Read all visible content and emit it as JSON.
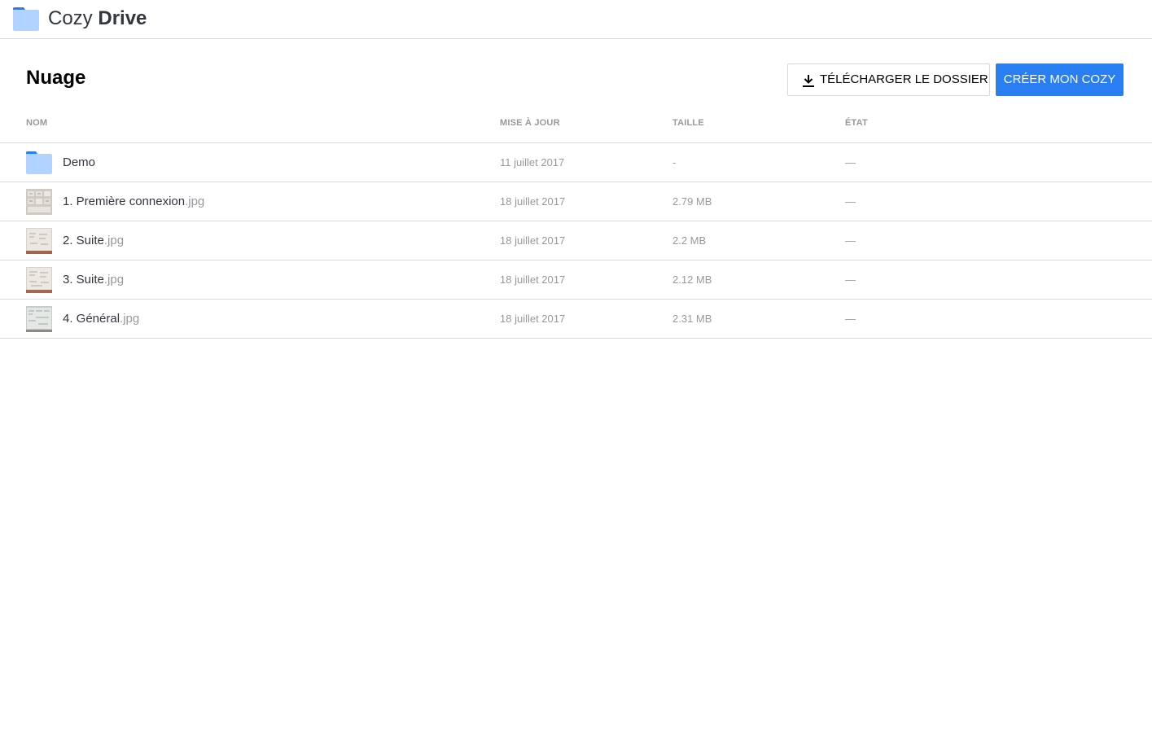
{
  "app": {
    "name_light": "Cozy",
    "name_bold": "Drive",
    "logo_icon": "folder-icon",
    "brand_color": "#297ef2"
  },
  "page": {
    "title": "Nuage"
  },
  "actions": {
    "download_label": "Télécharger le dossier",
    "download_icon": "download-icon",
    "create_label": "Créer mon Cozy"
  },
  "table": {
    "columns": {
      "name": "Nom",
      "updated": "Mise à jour",
      "size": "Taille",
      "state": "État"
    },
    "rows": [
      {
        "icon": "folder-icon",
        "name": "Demo",
        "ext": "",
        "date": "11 juillet 2017",
        "size": "-",
        "state": "—"
      },
      {
        "icon": "image-thumbnail",
        "name": "1. Première connexion",
        "ext": ".jpg",
        "date": "18 juillet 2017",
        "size": "2.79 MB",
        "state": "—"
      },
      {
        "icon": "image-thumbnail",
        "name": "2. Suite",
        "ext": ".jpg",
        "date": "18 juillet 2017",
        "size": "2.2 MB",
        "state": "—"
      },
      {
        "icon": "image-thumbnail",
        "name": "3. Suite",
        "ext": ".jpg",
        "date": "18 juillet 2017",
        "size": "2.12 MB",
        "state": "—"
      },
      {
        "icon": "image-thumbnail",
        "name": "4. Général",
        "ext": ".jpg",
        "date": "18 juillet 2017",
        "size": "2.31 MB",
        "state": "—"
      }
    ]
  }
}
